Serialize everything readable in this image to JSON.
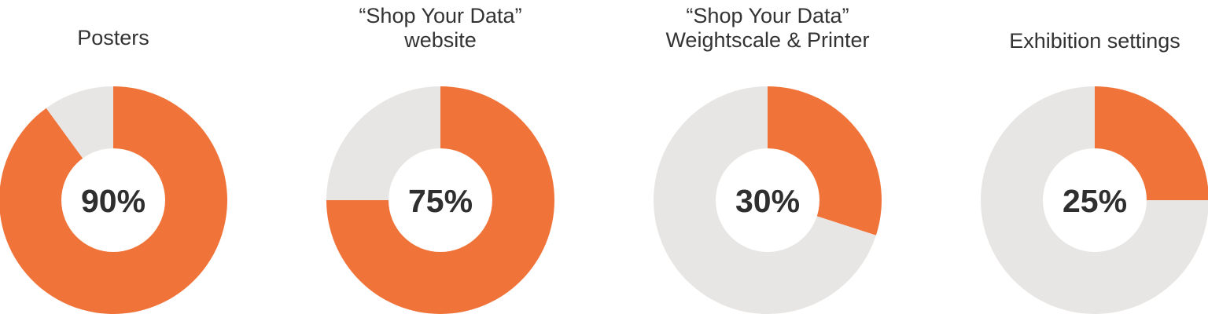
{
  "colors": {
    "filled": "#f07339",
    "remaining": "#e8e6e4",
    "hole": "#ffffff",
    "text": "#333333"
  },
  "chart_data": [
    {
      "type": "pie",
      "variant": "donut",
      "title_lines": [
        "Posters"
      ],
      "value": 90,
      "label": "90%",
      "slices": [
        {
          "value": 90,
          "color": "#f07339"
        },
        {
          "value": 10,
          "color": "#e8e6e4"
        }
      ]
    },
    {
      "type": "pie",
      "variant": "donut",
      "title_lines": [
        "“Shop Your Data”",
        "website"
      ],
      "value": 75,
      "label": "75%",
      "slices": [
        {
          "value": 75,
          "color": "#f07339"
        },
        {
          "value": 25,
          "color": "#e8e6e4"
        }
      ]
    },
    {
      "type": "pie",
      "variant": "donut",
      "title_lines": [
        "“Shop Your Data”",
        "Weightscale & Printer"
      ],
      "value": 30,
      "label": "30%",
      "slices": [
        {
          "value": 30,
          "color": "#f07339"
        },
        {
          "value": 70,
          "color": "#e8e6e4"
        }
      ]
    },
    {
      "type": "pie",
      "variant": "donut",
      "title_lines": [
        "Exhibition settings"
      ],
      "value": 25,
      "label": "25%",
      "slices": [
        {
          "value": 25,
          "color": "#f07339"
        },
        {
          "value": 75,
          "color": "#e8e6e4"
        }
      ]
    }
  ]
}
